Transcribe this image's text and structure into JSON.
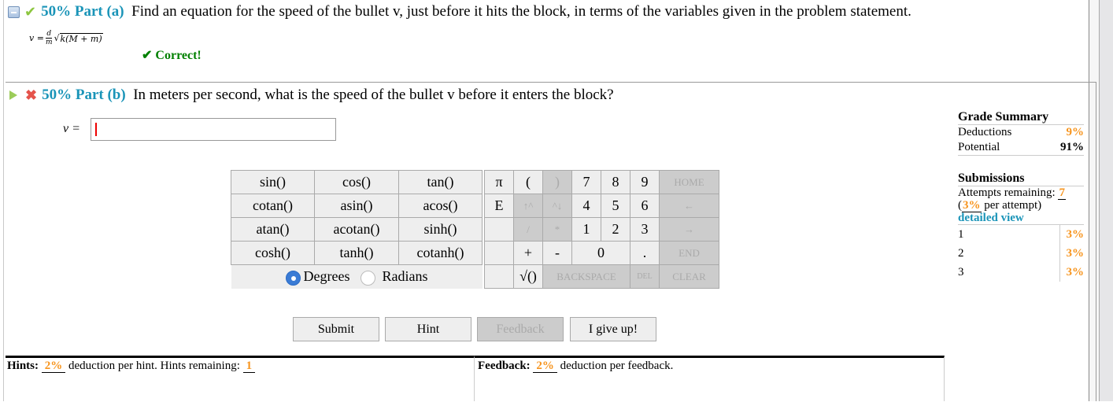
{
  "part_a": {
    "percent": "50%",
    "label": "Part (a)",
    "question": "Find an equation for the speed of the bullet v, just before it hits the block, in terms of the variables given in the problem statement.",
    "answer": {
      "lhs": "v =",
      "num": "d",
      "den": "m",
      "radicand": "k(M + m)"
    },
    "status": "✔ Correct!"
  },
  "part_b": {
    "percent": "50%",
    "label": "Part (b)",
    "question": "In meters per second, what is the speed of the bullet v before it enters the block?",
    "input_label": "v =",
    "input_value": ""
  },
  "keypad": {
    "functions": [
      [
        "sin()",
        "cos()",
        "tan()"
      ],
      [
        "cotan()",
        "asin()",
        "acos()"
      ],
      [
        "atan()",
        "acotan()",
        "sinh()"
      ],
      [
        "cosh()",
        "tanh()",
        "cotanh()"
      ]
    ],
    "angle_mode": {
      "degrees": "Degrees",
      "radians": "Radians",
      "selected": "Degrees"
    },
    "keys": {
      "pi": "π",
      "e": "E",
      "lparen": "(",
      "rparen": ")",
      "up": "↑^",
      "down": "^↓",
      "div": "/",
      "mul": "*",
      "plus": "+",
      "minus": "-",
      "sqrt": "√()",
      "dot": ".",
      "d7": "7",
      "d8": "8",
      "d9": "9",
      "d4": "4",
      "d5": "5",
      "d6": "6",
      "d1": "1",
      "d2": "2",
      "d3": "3",
      "d0": "0",
      "home": "HOME",
      "left": "←",
      "right": "→",
      "end": "END",
      "backspace": "BACKSPACE",
      "del": "DEL",
      "clear": "CLEAR"
    }
  },
  "actions": {
    "submit": "Submit",
    "hint": "Hint",
    "feedback": "Feedback",
    "give_up": "I give up!"
  },
  "grade_summary": {
    "title": "Grade Summary",
    "deductions_label": "Deductions",
    "deductions_value": "9%",
    "potential_label": "Potential",
    "potential_value": "91%"
  },
  "submissions": {
    "title": "Submissions",
    "attempts_label": "Attempts remaining:",
    "attempts_value": "7",
    "per_attempt_pre": "(",
    "per_attempt_value": "3%",
    "per_attempt_post": "per attempt)",
    "detailed_view": "detailed view",
    "rows": [
      {
        "n": "1",
        "p": "3%"
      },
      {
        "n": "2",
        "p": "3%"
      },
      {
        "n": "3",
        "p": "3%"
      }
    ]
  },
  "hints": {
    "label": "Hints:",
    "value": "2%",
    "text": "deduction per hint. Hints remaining:",
    "remaining": "1"
  },
  "feedback": {
    "label": "Feedback:",
    "value": "2%",
    "text": "deduction per feedback."
  }
}
